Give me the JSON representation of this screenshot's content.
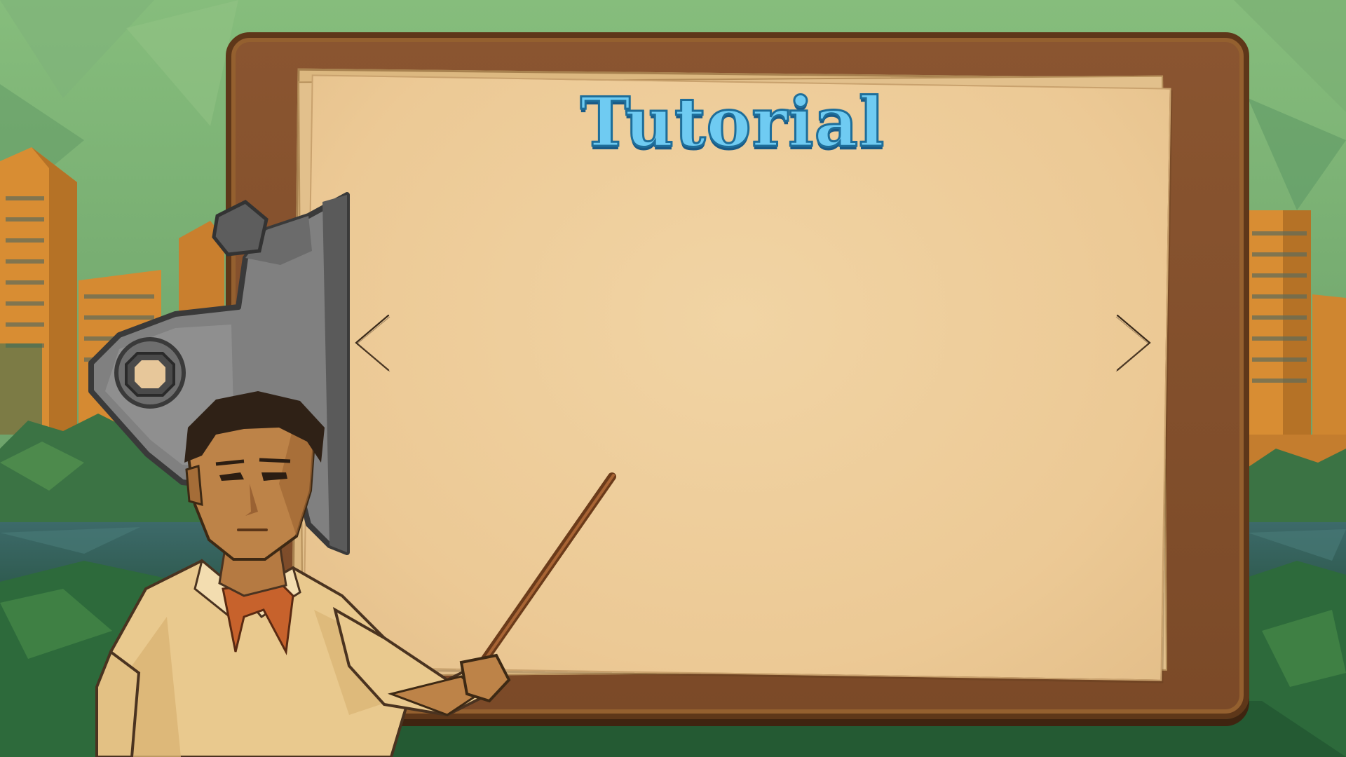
{
  "tutorial": {
    "title": "Tutorial"
  },
  "navigation": {
    "prev_icon": "chevron-left-icon",
    "next_icon": "chevron-right-icon"
  },
  "colors": {
    "title_fill": "#6fcbf2",
    "title_outline": "#1e6e9a",
    "clipboard_wood": "#7b4a28",
    "paper": "#ecc995"
  }
}
